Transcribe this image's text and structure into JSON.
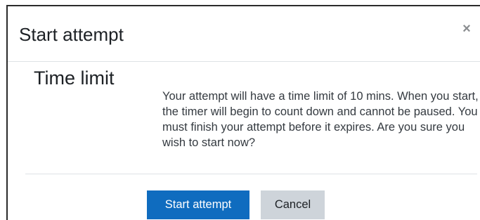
{
  "dialog": {
    "title": "Start attempt",
    "close_label": "×",
    "section_heading": "Time limit",
    "message": "Your attempt will have a time limit of 10 mins. When you start, the timer will begin to count down and cannot be paused. You must finish your attempt before it expires. Are you sure you wish to start now?",
    "primary_button_label": "Start attempt",
    "secondary_button_label": "Cancel"
  },
  "colors": {
    "primary": "#0f6cbf",
    "secondary": "#ced4da",
    "text": "#1d2125",
    "divider": "#dee2e6"
  },
  "icons": {
    "close": "close-icon"
  }
}
